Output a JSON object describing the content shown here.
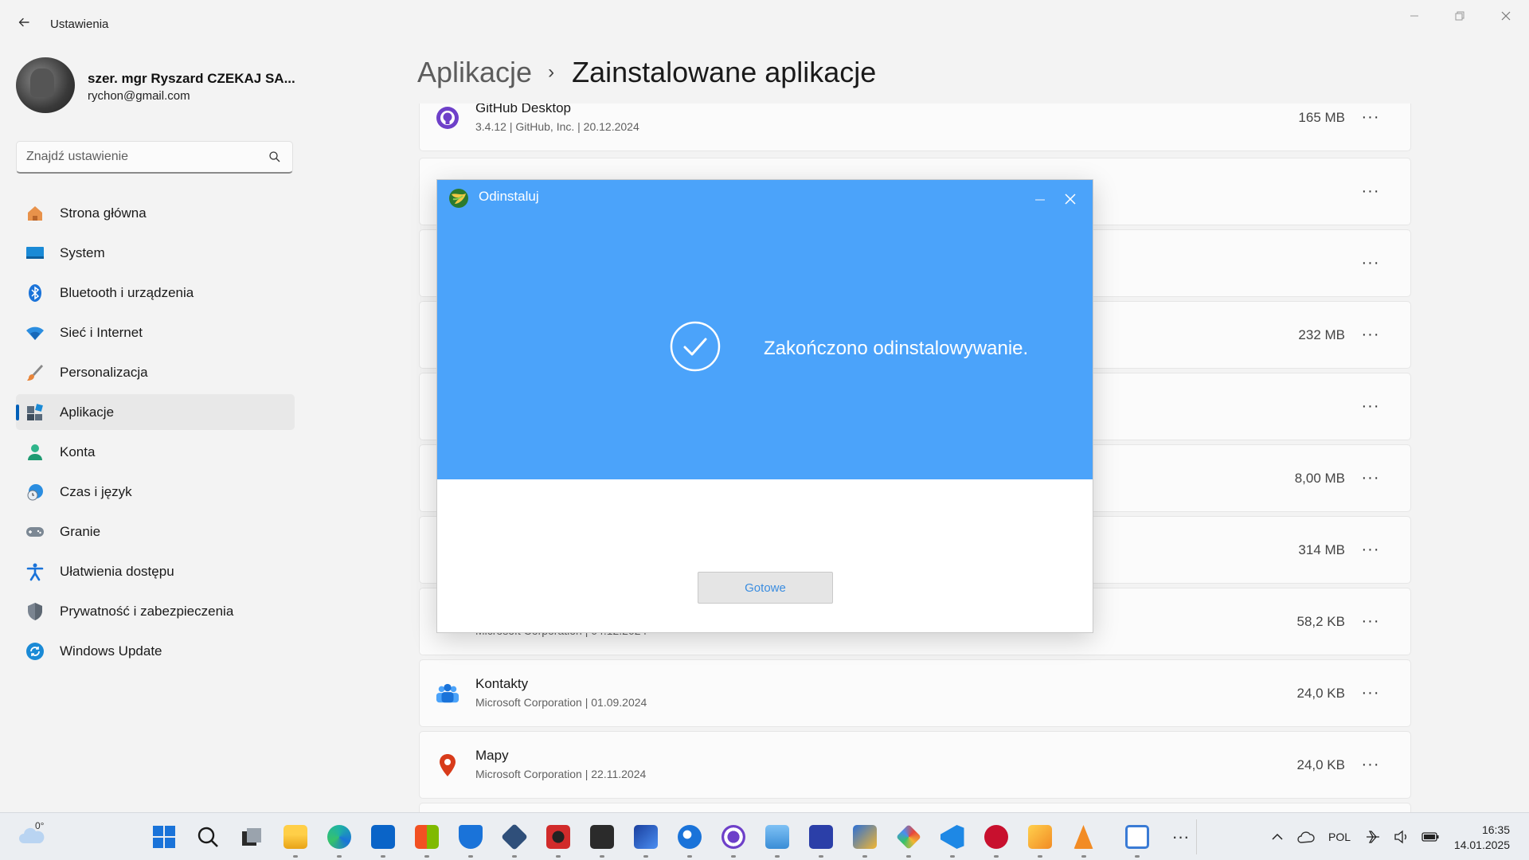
{
  "window": {
    "title": "Ustawienia",
    "back_icon": "back-arrow-icon"
  },
  "profile": {
    "name": "szer. mgr Ryszard CZEKAJ SA...",
    "email": "rychon@gmail.com"
  },
  "search": {
    "placeholder": "Znajdź ustawienie"
  },
  "nav": {
    "items": [
      {
        "label": "Strona główna",
        "icon": "home-icon"
      },
      {
        "label": "System",
        "icon": "system-icon"
      },
      {
        "label": "Bluetooth i urządzenia",
        "icon": "bluetooth-icon"
      },
      {
        "label": "Sieć i Internet",
        "icon": "wifi-icon"
      },
      {
        "label": "Personalizacja",
        "icon": "brush-icon"
      },
      {
        "label": "Aplikacje",
        "icon": "apps-icon",
        "active": true
      },
      {
        "label": "Konta",
        "icon": "account-icon"
      },
      {
        "label": "Czas i język",
        "icon": "time-language-icon"
      },
      {
        "label": "Granie",
        "icon": "gamepad-icon"
      },
      {
        "label": "Ułatwienia dostępu",
        "icon": "accessibility-icon"
      },
      {
        "label": "Prywatność i zabezpieczenia",
        "icon": "shield-icon"
      },
      {
        "label": "Windows Update",
        "icon": "update-icon"
      }
    ]
  },
  "breadcrumb": {
    "parent": "Aplikacje",
    "separator": "›",
    "current": "Zainstalowane aplikacje"
  },
  "apps": [
    {
      "name": "GitHub Desktop",
      "meta": "3.4.12  |  GitHub, Inc.  |  20.12.2024",
      "size": "165 MB"
    },
    {
      "name": "",
      "meta": "",
      "size": ""
    },
    {
      "name": "",
      "meta": "",
      "size": ""
    },
    {
      "name": "",
      "meta": "",
      "size": "232 MB"
    },
    {
      "name": "",
      "meta": "",
      "size": ""
    },
    {
      "name": "",
      "meta": "",
      "size": "8,00 MB"
    },
    {
      "name": "",
      "meta": "",
      "size": "314 MB"
    },
    {
      "name": "",
      "meta": "Microsoft Corporation  |  04.12.2024",
      "size": "58,2 KB"
    },
    {
      "name": "Kontakty",
      "meta": "Microsoft Corporation  |  01.09.2024",
      "size": "24,0 KB"
    },
    {
      "name": "Mapy",
      "meta": "Microsoft Corporation  |  22.11.2024",
      "size": "24,0 KB"
    }
  ],
  "more_label": "···",
  "dialog": {
    "title": "Odinstaluj",
    "message": "Zakończono odinstalowywanie.",
    "button": "Gotowe",
    "colors": {
      "header": "#4ba3fa",
      "button_text": "#3b8de0"
    }
  },
  "taskbar": {
    "weather_temp": "0°",
    "pinned": [
      {
        "icon": "start-icon"
      },
      {
        "icon": "search-icon"
      },
      {
        "icon": "task-view-icon"
      },
      {
        "icon": "file-explorer-icon"
      },
      {
        "icon": "edge-icon"
      },
      {
        "icon": "outlook-icon"
      },
      {
        "icon": "store-icon"
      },
      {
        "icon": "defender-icon"
      },
      {
        "icon": "virtualbox-icon"
      },
      {
        "icon": "app-red-icon"
      },
      {
        "icon": "terminal-icon"
      },
      {
        "icon": "app-blue-a-icon"
      },
      {
        "icon": "app-globe-icon"
      },
      {
        "icon": "github-desktop-icon"
      },
      {
        "icon": "app-monitor-icon"
      },
      {
        "icon": "save-disk-icon"
      },
      {
        "icon": "network-app-icon"
      },
      {
        "icon": "git-icon"
      },
      {
        "icon": "vscode-icon"
      },
      {
        "icon": "app-red-circle-icon"
      },
      {
        "icon": "media-player-icon"
      },
      {
        "icon": "vlc-icon"
      },
      {
        "icon": "settings-window-icon"
      },
      {
        "icon": "more-apps-icon"
      }
    ],
    "tray": {
      "language": "POL",
      "time": "16:35",
      "date": "14.01.2025"
    }
  }
}
